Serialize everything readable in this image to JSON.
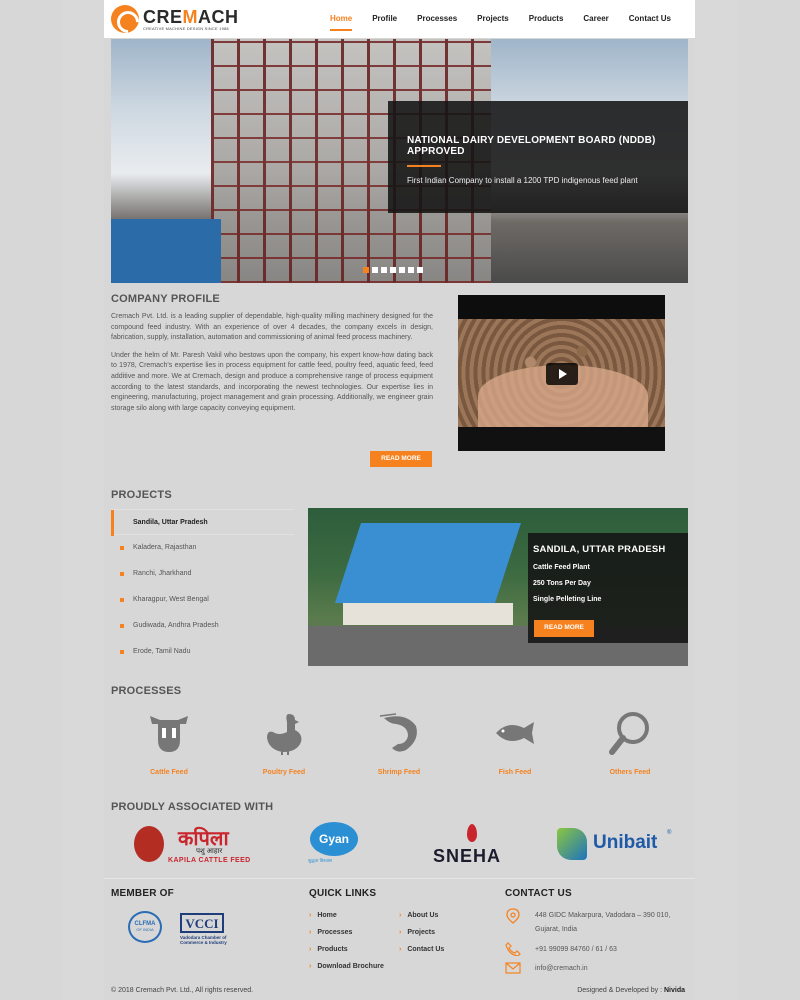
{
  "header": {
    "logo_name_prefix": "CRE",
    "logo_name_accent": "M",
    "logo_name_suffix": "ACH",
    "logo_tagline": "CREATIVE MACHINE DESIGN SINCE 1988",
    "nav": [
      "Home",
      "Profile",
      "Processes",
      "Projects",
      "Products",
      "Career",
      "Contact Us"
    ],
    "active_nav": "Home"
  },
  "hero": {
    "title": "NATIONAL DAIRY DEVELOPMENT BOARD (NDDB) APPROVED",
    "subtitle": "First Indian Company to install a 1200 TPD indigenous feed plant",
    "slide_count": 7,
    "active_slide": 1
  },
  "profile": {
    "heading": "COMPANY PROFILE",
    "para1": "Cremach Pvt. Ltd. is a leading supplier of dependable, high-quality milling machinery designed for the compound feed industry. With an experience of over 4 decades, the company excels in design, fabrication, supply, installation, automation and commissioning of animal feed process machinery.",
    "para2": "Under the helm of Mr. Paresh Vakil who bestows upon the company, his expert know-how dating back to 1978, Cremach's expertise lies in process equipment for cattle feed, poultry feed, aquatic feed, feed additive and more. We at Cremach, design and produce a comprehensive range of process equipment according to the latest standards, and incorporating the newest technologies. Our expertise lies in engineering, manufacturing, project management and grain processing. Additionally, we engineer grain storage silo along with large capacity conveying equipment.",
    "read_more": "READ MORE"
  },
  "projects": {
    "heading": "PROJECTS",
    "items": [
      "Sandila, Uttar Pradesh",
      "Kaladera, Rajasthan",
      "Ranchi, Jharkhand",
      "Kharagpur, West Bengal",
      "Gudiwada, Andhra Pradesh",
      "Erode, Tamil Nadu"
    ],
    "active_index": 0,
    "feature": {
      "title": "SANDILA, UTTAR PRADESH",
      "lines": [
        "Cattle Feed Plant",
        "250 Tons Per Day",
        "Single Pelleting Line"
      ],
      "button": "READ MORE"
    }
  },
  "processes": {
    "heading": "PROCESSES",
    "items": [
      {
        "label": "Cattle Feed",
        "icon": "cow-icon"
      },
      {
        "label": "Poultry Feed",
        "icon": "hen-icon"
      },
      {
        "label": "Shrimp Feed",
        "icon": "shrimp-icon"
      },
      {
        "label": "Fish Feed",
        "icon": "fish-icon"
      },
      {
        "label": "Others Feed",
        "icon": "magnifier-icon"
      }
    ]
  },
  "associated": {
    "heading": "PROUDLY ASSOCIATED WITH",
    "logos": [
      {
        "name": "कपिला",
        "sub1": "पशु आहार",
        "sub2": "KAPILA CATTLE FEED"
      },
      {
        "name": "Gyan",
        "sub1": "शुद्धता विश्वास",
        "sub2": ""
      },
      {
        "name": "SNEHA",
        "sub1": "",
        "sub2": ""
      },
      {
        "name": "Unibait",
        "sub1": "®",
        "sub2": ""
      }
    ]
  },
  "footer": {
    "member_heading": "MEMBER OF",
    "member_logos": [
      {
        "name": "CLFMA",
        "sub": "OF INDIA"
      },
      {
        "name": "VCCI",
        "sub": "Vadodara Chamber of Commerce & Industry"
      }
    ],
    "links_heading": "QUICK LINKS",
    "links_col1": [
      "Home",
      "Processes",
      "Products",
      "Download Brochure"
    ],
    "links_col2": [
      "About Us",
      "Projects",
      "Contact Us"
    ],
    "contact_heading": "CONTACT US",
    "address_line1": "448 GIDC Makarpura, Vadodara – 390 010,",
    "address_line2": "Gujarat, India",
    "phone": "+91 99099 84760 / 61 / 63",
    "email": "info@cremach.in",
    "copyright": "© 2018 Cremach Pvt. Ltd., All rights reserved.",
    "credit_label": "Designed & Developed by :",
    "credit_name": "Nivida"
  },
  "colors": {
    "accent": "#f5821f",
    "dark": "#141414",
    "text": "#555555"
  }
}
